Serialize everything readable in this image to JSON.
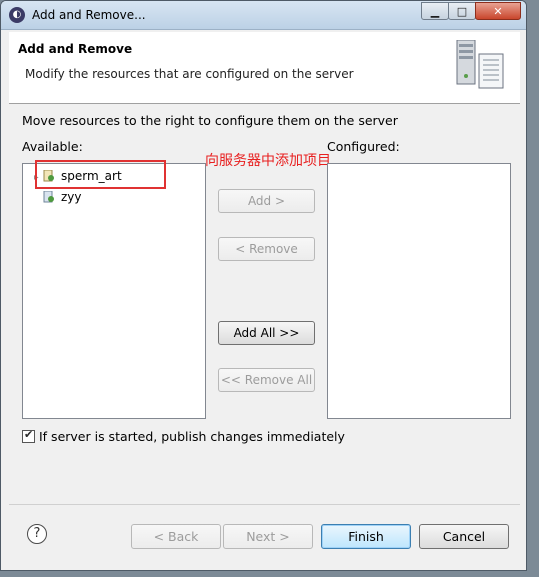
{
  "window": {
    "title": "Add and Remove...",
    "minimize_glyph": "▁",
    "maximize_glyph": "□",
    "close_glyph": "✕"
  },
  "header": {
    "title": "Add and Remove",
    "description": "Modify the resources that are configured on the server",
    "icon": "server-icon"
  },
  "body": {
    "instruction": "Move resources to the right to configure them on the server",
    "available_label": "Available:",
    "configured_label": "Configured:",
    "available_items": [
      {
        "label": "sperm_art",
        "icon": "web-project-icon"
      },
      {
        "label": "zyy",
        "icon": "web-project-icon"
      }
    ],
    "configured_items": [],
    "annotation": "向服务器中添加项目",
    "buttons": {
      "add": "Add >",
      "remove": "< Remove",
      "add_all": "Add All >>",
      "remove_all": "<< Remove All"
    },
    "publish_checkbox": {
      "label": "If server is started, publish changes immediately",
      "checked": true
    }
  },
  "footer": {
    "help": "?",
    "back": "< Back",
    "next": "Next >",
    "finish": "Finish",
    "cancel": "Cancel"
  }
}
